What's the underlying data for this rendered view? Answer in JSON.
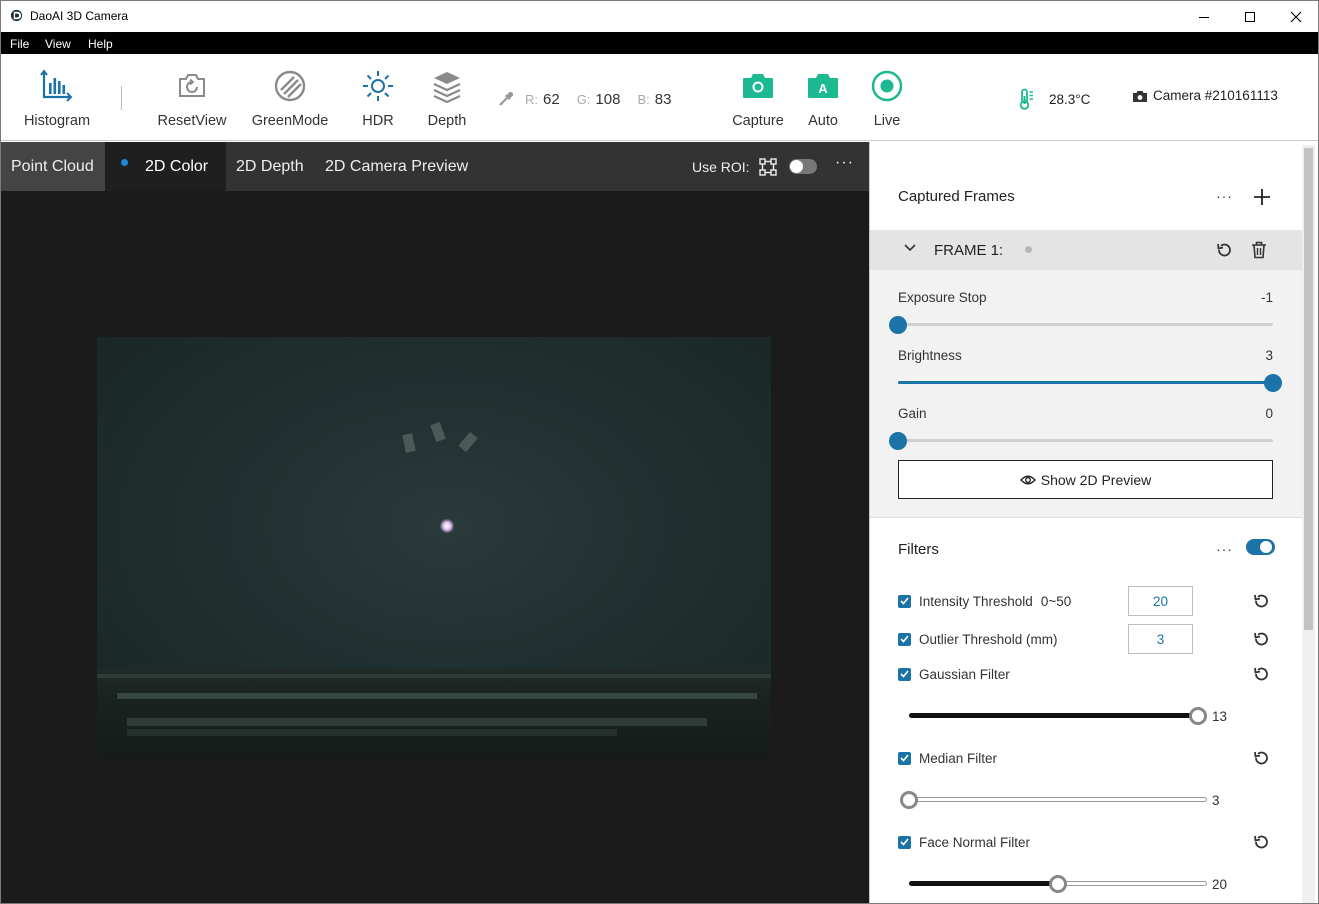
{
  "window": {
    "title": "DaoAI 3D Camera"
  },
  "menu": {
    "items": [
      "File",
      "View",
      "Help"
    ]
  },
  "toolbar": {
    "histogram": "Histogram",
    "reset_view": "ResetView",
    "green_mode": "GreenMode",
    "hdr": "HDR",
    "depth": "Depth",
    "capture": "Capture",
    "auto": "Auto",
    "live": "Live",
    "rgb": {
      "r_label": "R:",
      "r": "62",
      "g_label": "G:",
      "g": "108",
      "b_label": "B:",
      "b": "83"
    },
    "temperature": "28.3°C",
    "camera": "Camera #210161113",
    "accent_color": "#1db992",
    "icon_blue": "#1b73a8"
  },
  "viewer": {
    "tabs": [
      "Point Cloud",
      "2D Color",
      "2D Depth",
      "2D Camera Preview"
    ],
    "active_tab": "2D Color",
    "roi_label": "Use ROI:",
    "roi_enabled": false,
    "more": "···"
  },
  "panel": {
    "captured_frames_title": "Captured Frames",
    "more": "···",
    "frame": {
      "title": "FRAME 1:",
      "exposure_label": "Exposure Stop",
      "exposure_value": "-1",
      "exposure_fraction": 0.0,
      "brightness_label": "Brightness",
      "brightness_value": "3",
      "brightness_fraction": 1.0,
      "gain_label": "Gain",
      "gain_value": "0",
      "gain_fraction": 0.0,
      "preview_button": "Show 2D Preview"
    },
    "filters": {
      "title": "Filters",
      "enabled": true,
      "intensity_label": "Intensity Threshold",
      "intensity_range": "0~50",
      "intensity_value": "20",
      "outlier_label": "Outlier Threshold (mm)",
      "outlier_value": "3",
      "gaussian_label": "Gaussian Filter",
      "gaussian_value": "13",
      "gaussian_fraction": 0.97,
      "median_label": "Median Filter",
      "median_value": "3",
      "median_fraction": 0.0,
      "face_normal_label": "Face Normal Filter",
      "face_normal_value": "20",
      "face_normal_fraction": 0.5
    }
  }
}
